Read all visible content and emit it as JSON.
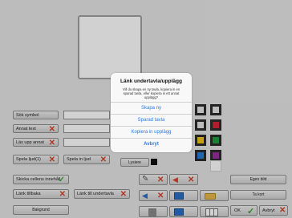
{
  "left_buttons": {
    "search_symbol": "Sök symbol",
    "other_text": "Annat text",
    "read_other": "Läs upp annat",
    "play_sound_1": "Spela ljud(1)",
    "play_sound": "Spela in ljud",
    "send_cell_content": "Skicka cellens innehåll",
    "link_back": "Länk tillbaka",
    "link_to_subtable": "Länk till undertavla",
    "background": "Bakgrund"
  },
  "middle": {
    "light_label": "Lysiere"
  },
  "right_buttons": {
    "own_image": "Egen bild",
    "take_photo": "Ta kort",
    "ok": "OK",
    "cancel": "Avbryt"
  },
  "colors": {
    "swatch_row1": [
      "#ffffff",
      "#ffffff"
    ],
    "swatch_row2": [
      "#ffffff",
      "#d9233a"
    ],
    "swatch_row3": [
      "#f2c31c",
      "#1f9e3a"
    ],
    "swatch_row4": [
      "#2a7ad6",
      "#9b2fa3"
    ],
    "accent": "#2c7be5"
  },
  "dialog": {
    "title": "Länk undertavla/upplägg",
    "message": "Vill du skapa en ny tavla, kopiera in en sparad tavla, eller kopiera in ett annat upplägg?",
    "options": [
      "Skapa ny",
      "Sparad tavla",
      "Kopiera in upplägg",
      "Avbryt"
    ]
  }
}
